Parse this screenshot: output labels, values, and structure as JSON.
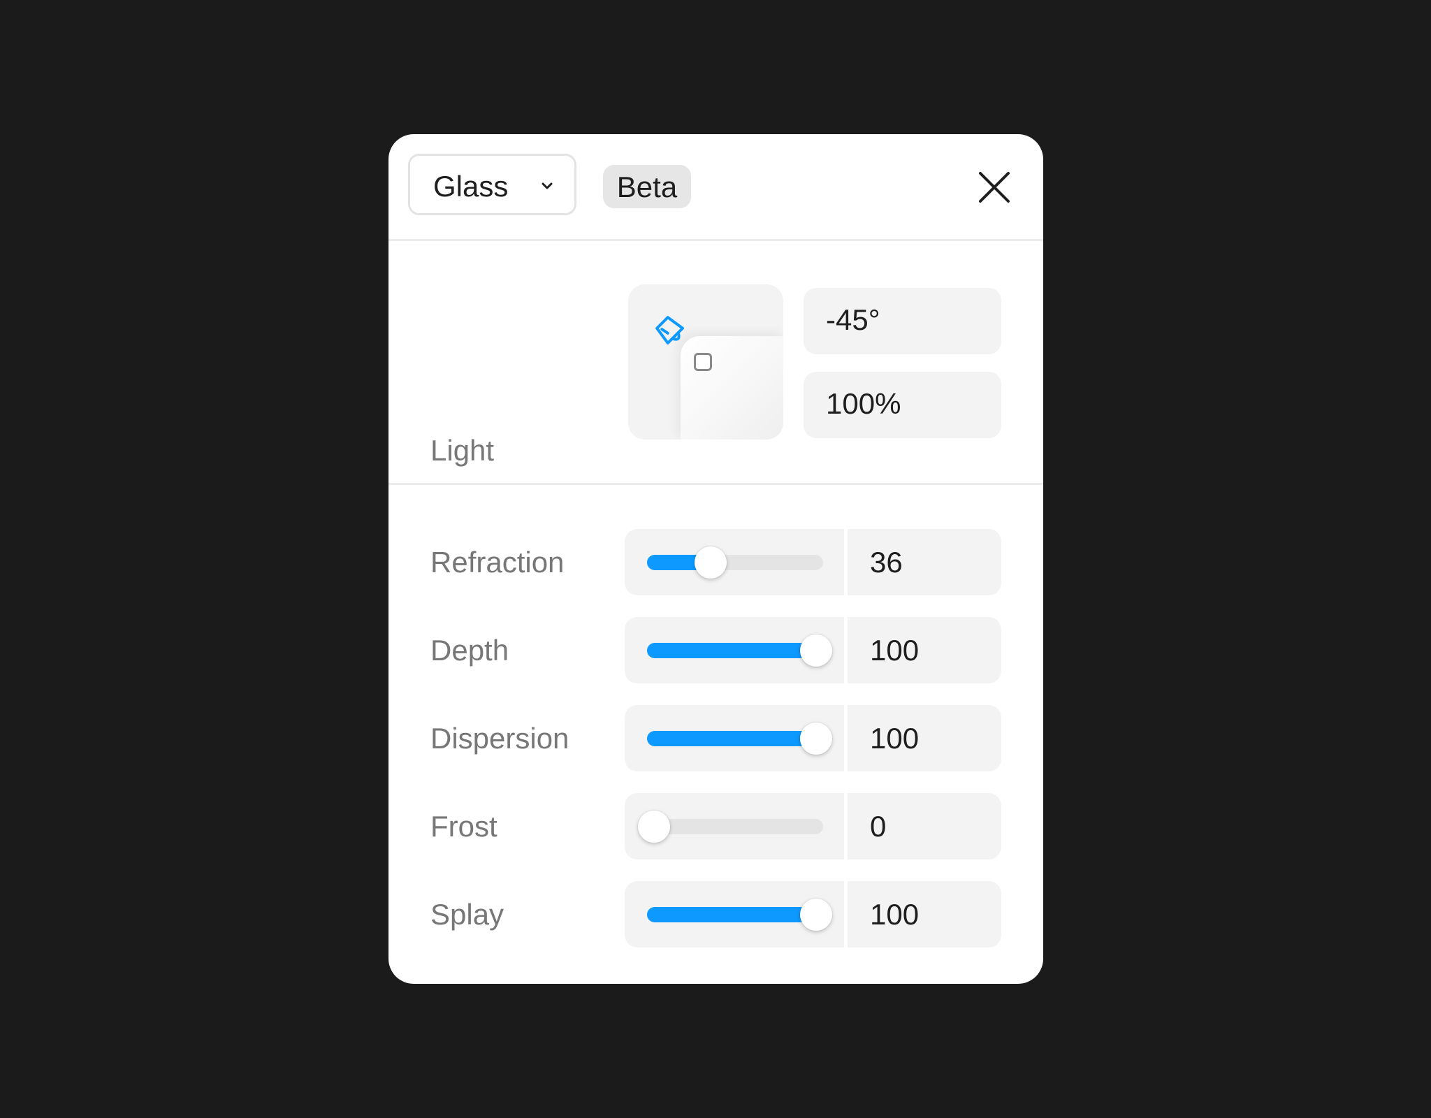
{
  "header": {
    "effect_select": "Glass",
    "badge": "Beta"
  },
  "light": {
    "label": "Light",
    "angle": "-45°",
    "intensity": "100%"
  },
  "sliders": [
    {
      "label": "Refraction",
      "value": "36",
      "level": 0.36
    },
    {
      "label": "Depth",
      "value": "100",
      "level": 1.0
    },
    {
      "label": "Dispersion",
      "value": "100",
      "level": 1.0
    },
    {
      "label": "Frost",
      "value": "0",
      "level": 0.0
    },
    {
      "label": "Splay",
      "value": "100",
      "level": 1.0
    }
  ],
  "colors": {
    "accent": "#0d99ff",
    "background": "#1b1b1b",
    "panel": "#ffffff",
    "field": "#f3f3f3"
  },
  "icons": {
    "dropdown": "chevron-down-icon",
    "close": "close-icon",
    "light": "light-source-icon"
  }
}
